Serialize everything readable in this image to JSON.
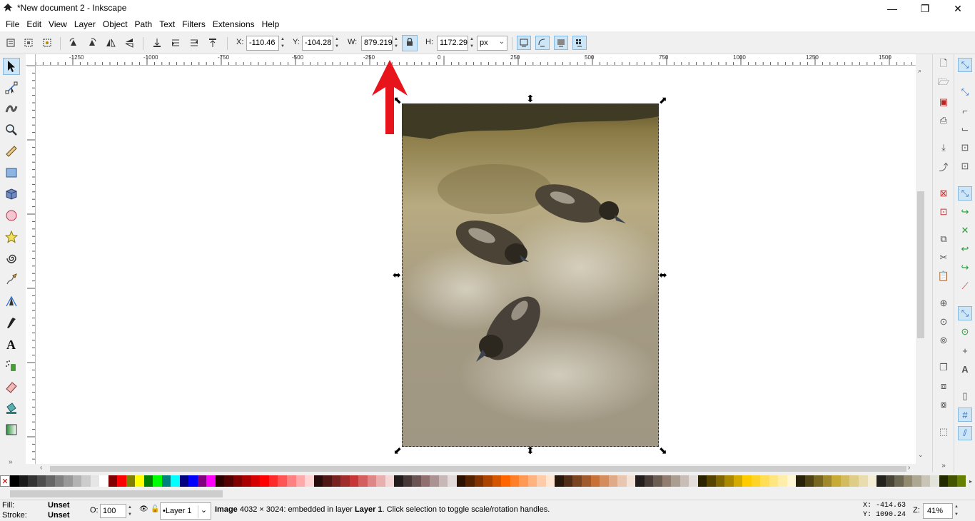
{
  "window": {
    "title": "*New document 2 - Inkscape",
    "app_icon": "inkscape-icon",
    "controls": {
      "minimize": "—",
      "maximize": "❐",
      "close": "✕"
    }
  },
  "menu": [
    "File",
    "Edit",
    "View",
    "Layer",
    "Object",
    "Path",
    "Text",
    "Filters",
    "Extensions",
    "Help"
  ],
  "toolbar": {
    "x_label": "X:",
    "x_value": "-110.46",
    "y_label": "Y:",
    "y_value": "-104.28",
    "w_label": "W:",
    "w_value": "879.219",
    "h_label": "H:",
    "h_value": "1172.29",
    "unit": "px"
  },
  "rulers": {
    "horizontal": [
      "-1250",
      "-1000",
      "-750",
      "-500",
      "-250",
      "0",
      "250",
      "500",
      "750",
      "1000",
      "1250",
      "1500"
    ],
    "vertical": [
      "0",
      "-500",
      "-250",
      "0",
      "250",
      "500",
      "750",
      "1000",
      "0"
    ]
  },
  "tools": [
    "selector-tool",
    "node-tool",
    "tweak-tool",
    "zoom-tool",
    "measure-tool",
    "rectangle-tool",
    "3d-box-tool",
    "ellipse-tool",
    "star-tool",
    "spiral-tool",
    "pencil-tool",
    "pen-tool",
    "calligraphy-tool",
    "text-tool",
    "spray-tool",
    "eraser-tool",
    "paint-bucket-tool",
    "gradient-tool"
  ],
  "annotation": {
    "color": "#e8141c",
    "meaning": "arrow pointing to W field"
  },
  "palette": {
    "none_symbol": "✕",
    "colors": [
      "#000000",
      "#1a1a1a",
      "#333333",
      "#4d4d4d",
      "#666666",
      "#808080",
      "#999999",
      "#b3b3b3",
      "#cccccc",
      "#e6e6e6",
      "#ffffff",
      "#800000",
      "#ff0000",
      "#808000",
      "#ffff00",
      "#008000",
      "#00ff00",
      "#008080",
      "#00ffff",
      "#000080",
      "#0000ff",
      "#800080",
      "#ff00ff",
      "#2b0000",
      "#550000",
      "#800000",
      "#aa0000",
      "#d40000",
      "#ff0000",
      "#ff2a2a",
      "#ff5555",
      "#ff8080",
      "#ffaaaa",
      "#ffd5d5",
      "#280b0b",
      "#501616",
      "#782121",
      "#a02c2c",
      "#c83737",
      "#d35f5f",
      "#de8787",
      "#e9afaf",
      "#f4d7d7",
      "#241c1c",
      "#483737",
      "#6c5353",
      "#916f6f",
      "#ac9393",
      "#c8b7b7",
      "#e3dbdb",
      "#2b1100",
      "#552200",
      "#803300",
      "#aa4400",
      "#d45500",
      "#ff6600",
      "#ff7f2a",
      "#ff9955",
      "#ffb380",
      "#ffccaa",
      "#ffe6d5",
      "#28170b",
      "#502d16",
      "#784421",
      "#a05a2c",
      "#c87137",
      "#d38d5f",
      "#deaa87",
      "#e9c6af",
      "#f4e3d7",
      "#241f1c",
      "#483e37",
      "#6c5d53",
      "#917c6f",
      "#ac9d93",
      "#c8beb7",
      "#e3dedb",
      "#2b2200",
      "#554400",
      "#806600",
      "#aa8800",
      "#d4aa00",
      "#ffcc00",
      "#ffd42a",
      "#ffdd55",
      "#ffe680",
      "#ffeeaa",
      "#fff6d5",
      "#28220b",
      "#504416",
      "#786721",
      "#a0892c",
      "#c8ab37",
      "#d3bc5f",
      "#decd87",
      "#e9ddaf",
      "#f4eed7",
      "#24221c",
      "#484537",
      "#6c6753",
      "#918a6f",
      "#aca793",
      "#c8c4b7",
      "#e3e2db",
      "#222b00",
      "#445500",
      "#668000"
    ]
  },
  "status": {
    "fill_label": "Fill:",
    "fill_value": "Unset",
    "stroke_label": "Stroke:",
    "stroke_value": "Unset",
    "opacity_label": "O:",
    "opacity_value": "100",
    "layer": "•Layer 1",
    "message_bold": "Image",
    "message_a": " 4032 × 3024: embedded in layer ",
    "message_layer": "Layer 1",
    "message_b": ". Click selection to toggle scale/rotation handles.",
    "cursor_x": "X: -414.63",
    "cursor_y": "Y: 1090.24",
    "zoom_label": "Z:",
    "zoom_value": "41%"
  }
}
